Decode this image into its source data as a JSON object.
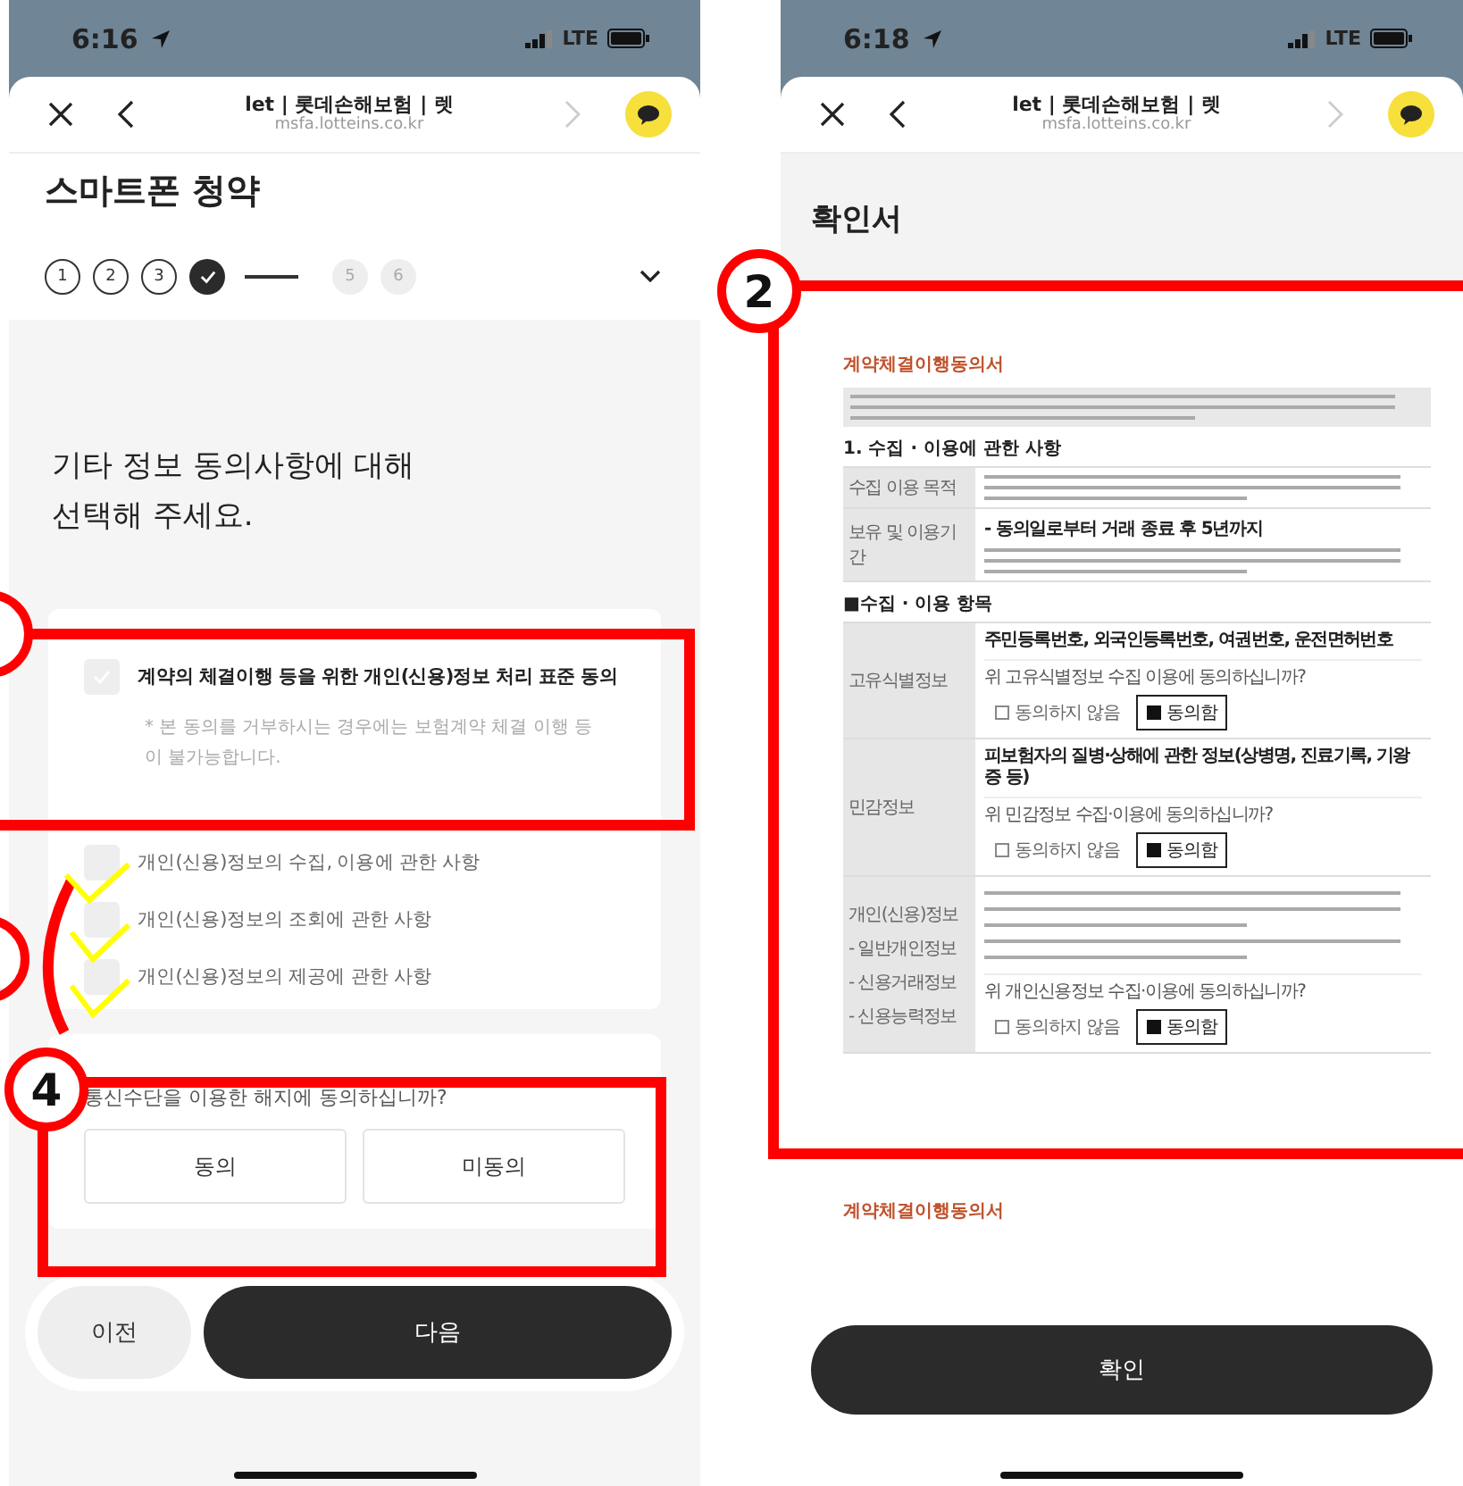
{
  "left_screen": {
    "status_bar": {
      "time": "6:16",
      "network": "LTE"
    },
    "browser_bar": {
      "title": "let | 롯데손해보험 | 렛",
      "url": "msfa.lotteins.co.kr"
    },
    "page_title": "스마트폰 청약",
    "steps": [
      {
        "label": "1",
        "completed": true,
        "current": false
      },
      {
        "label": "2",
        "completed": true,
        "current": false
      },
      {
        "label": "3",
        "completed": true,
        "current": false
      },
      {
        "completed": false,
        "current": true
      },
      {
        "label": "5",
        "completed": false,
        "current": false
      },
      {
        "label": "6",
        "completed": false,
        "current": false
      }
    ],
    "prompt": "기타 정보 동의사항에 대해\n선택해 주세요.",
    "consent_card": {
      "main": {
        "label": "계약의 체결이행 등을 위한 개인(신용)정보 처리 표준 동의",
        "checked": false,
        "note": "* 본 동의를 거부하시는 경우에는 보험계약 체결 이행 등이 불가능합니다."
      },
      "items": [
        {
          "label": "개인(신용)정보의 수집, 이용에 관한 사항",
          "checked": false
        },
        {
          "label": "개인(신용)정보의 조회에 관한 사항",
          "checked": false
        },
        {
          "label": "개인(신용)정보의 제공에 관한 사항",
          "checked": false
        }
      ]
    },
    "termination": {
      "question": "통신수단을 이용한 해지에 동의하십니까?",
      "options": [
        {
          "label": "동의",
          "selected": false
        },
        {
          "label": "미동의",
          "selected": false
        }
      ]
    },
    "footer_buttons": [
      {
        "label": "이전",
        "kind": "secondary"
      },
      {
        "label": "다음",
        "kind": "primary"
      }
    ]
  },
  "right_screen": {
    "status_bar": {
      "time": "6:18",
      "network": "LTE"
    },
    "browser_bar": {
      "title": "let | 롯데손해보험 | 렛",
      "url": "msfa.lotteins.co.kr"
    },
    "page_title": "확인서",
    "document": {
      "title": "계약체결이행동의서",
      "section_1": "1. 수집 · 이용에 관한 사항",
      "rows": [
        {
          "label": "수집 이용 목적"
        },
        {
          "label": "보유 및 이용기간",
          "highlight": "- 동의일로부터 거래 종료 후 5년까지"
        }
      ],
      "section_2": "■수집 · 이용 항목",
      "items": [
        {
          "label": "고유식별정보",
          "detail": "주민등록번호, 외국인등록번호, 여권번호, 운전면허번호",
          "question": "위 고유식별정보 수집 이용에 동의하십니까?",
          "options": [
            {
              "label": "동의하지 않음",
              "selected": false
            },
            {
              "label": "동의함",
              "selected": true
            }
          ]
        },
        {
          "label": "민감정보",
          "detail": "피보험자의 질병·상해에 관한 정보(상병명, 진료기록, 기왕증 등)",
          "question": "위 민감정보 수집·이용에 동의하십니까?",
          "options": [
            {
              "label": "동의하지 않음",
              "selected": false
            },
            {
              "label": "동의함",
              "selected": true
            }
          ]
        },
        {
          "label": "개인(신용)정보",
          "sublabels": [
            "- 일반개인정보",
            "- 신용거래정보",
            "- 신용능력정보"
          ],
          "question": "위 개인신용정보 수집·이용에 동의하십니까?",
          "options": [
            {
              "label": "동의하지 않음",
              "selected": false
            },
            {
              "label": "동의함",
              "selected": true
            }
          ]
        }
      ]
    },
    "next_page_title": "계약체결이행동의서",
    "confirm_button": "확인"
  },
  "annotations": {
    "markers": [
      {
        "label": "2"
      },
      {
        "label": "4"
      }
    ]
  }
}
